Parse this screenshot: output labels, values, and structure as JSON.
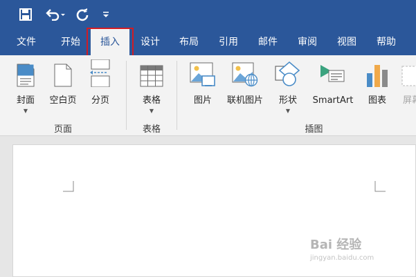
{
  "tabs": [
    {
      "label": "文件"
    },
    {
      "label": "开始"
    },
    {
      "label": "插入"
    },
    {
      "label": "设计"
    },
    {
      "label": "布局"
    },
    {
      "label": "引用"
    },
    {
      "label": "邮件"
    },
    {
      "label": "审阅"
    },
    {
      "label": "视图"
    },
    {
      "label": "帮助"
    }
  ],
  "ribbon": {
    "buttons": [
      {
        "label": "封面",
        "icon": "cover-page-icon"
      },
      {
        "label": "空白页",
        "icon": "blank-page-icon"
      },
      {
        "label": "分页",
        "icon": "page-break-icon"
      },
      {
        "label": "表格",
        "icon": "table-icon"
      },
      {
        "label": "图片",
        "icon": "picture-icon"
      },
      {
        "label": "联机图片",
        "icon": "online-picture-icon"
      },
      {
        "label": "形状",
        "icon": "shapes-icon"
      },
      {
        "label": "SmartArt",
        "icon": "smartart-icon"
      },
      {
        "label": "图表",
        "icon": "chart-icon"
      },
      {
        "label": "屏幕",
        "icon": "screenshot-icon"
      }
    ],
    "groups": [
      {
        "label": "页面"
      },
      {
        "label": "表格"
      },
      {
        "label": "插图"
      }
    ]
  },
  "quick_access": [
    {
      "icon": "save-icon"
    },
    {
      "icon": "undo-icon"
    },
    {
      "icon": "redo-icon"
    },
    {
      "icon": "customize-qat-icon"
    }
  ],
  "watermark": {
    "text": "Bai 经验",
    "sub": "jingyan.baidu.com"
  },
  "colors": {
    "brand": "#2b579a",
    "highlight": "#d21b23"
  }
}
